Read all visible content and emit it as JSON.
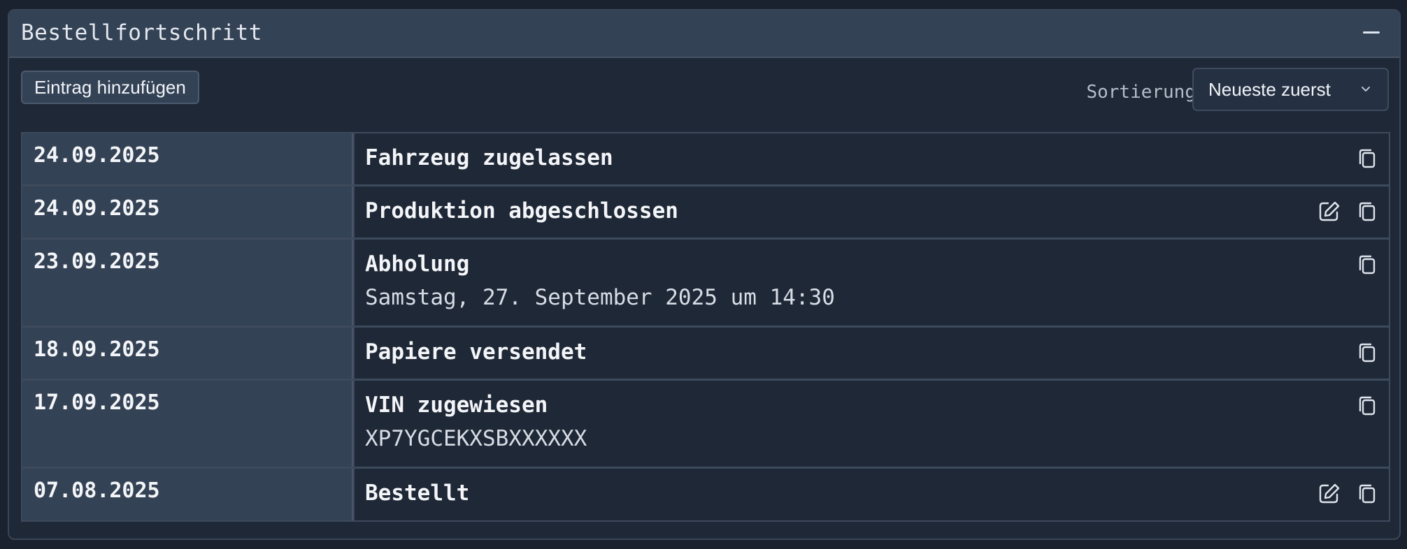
{
  "panel": {
    "title": "Bestellfortschritt"
  },
  "toolbar": {
    "add_label": "Eintrag hinzufügen",
    "sort_label": "Sortierung",
    "sort_value": "Neueste zuerst"
  },
  "entries": [
    {
      "date": "24.09.2025",
      "title": "Fahrzeug zugelassen",
      "detail": "",
      "editable": false
    },
    {
      "date": "24.09.2025",
      "title": "Produktion abgeschlossen",
      "detail": "",
      "editable": true
    },
    {
      "date": "23.09.2025",
      "title": "Abholung",
      "detail": "Samstag, 27. September 2025 um 14:30",
      "editable": false
    },
    {
      "date": "18.09.2025",
      "title": "Papiere versendet",
      "detail": "",
      "editable": false
    },
    {
      "date": "17.09.2025",
      "title": "VIN zugewiesen",
      "detail": "XP7YGCEKXSBXXXXXX",
      "editable": false
    },
    {
      "date": "07.08.2025",
      "title": "Bestellt",
      "detail": "",
      "editable": true
    }
  ],
  "icons": {
    "collapse": "minus-icon",
    "sort": "chevron-down-icon",
    "edit": "edit-icon",
    "copy": "copy-icon"
  },
  "colors": {
    "background": "#1a2230",
    "header": "#344255",
    "date_cell": "#344255",
    "event_cell": "#1f2836",
    "text": "#f3f5f8"
  }
}
